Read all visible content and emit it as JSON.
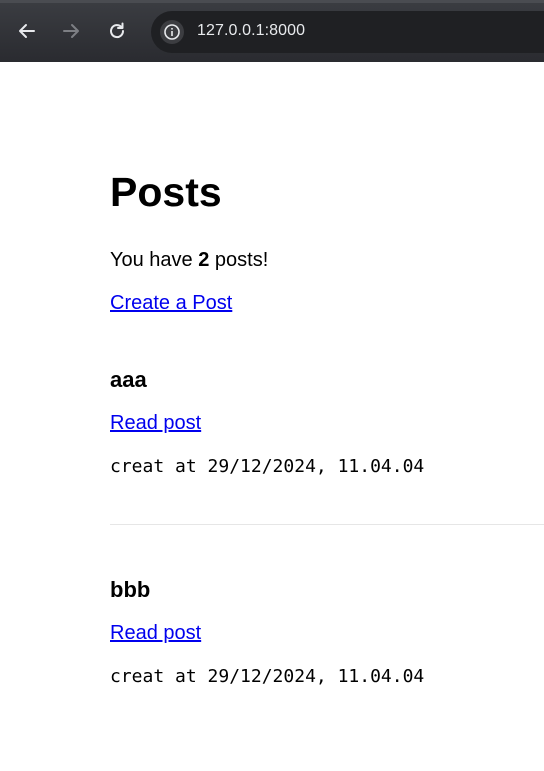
{
  "browser": {
    "url": "127.0.0.1:8000",
    "back_icon": "arrow-left-icon",
    "forward_icon": "arrow-right-icon",
    "reload_icon": "reload-icon",
    "info_icon": "info-icon"
  },
  "page": {
    "title": "Posts",
    "count_prefix": "You have ",
    "count": "2",
    "count_suffix": " posts!",
    "create_link": "Create a Post"
  },
  "posts": [
    {
      "title": "aaa",
      "read_label": "Read post",
      "created": "creat at 29/12/2024, 11.04.04"
    },
    {
      "title": "bbb",
      "read_label": "Read post",
      "created": "creat at 29/12/2024, 11.04.04"
    }
  ],
  "colors": {
    "link": "#0000ee",
    "toolbar": "#35363a",
    "omnibox": "#1f2023"
  }
}
